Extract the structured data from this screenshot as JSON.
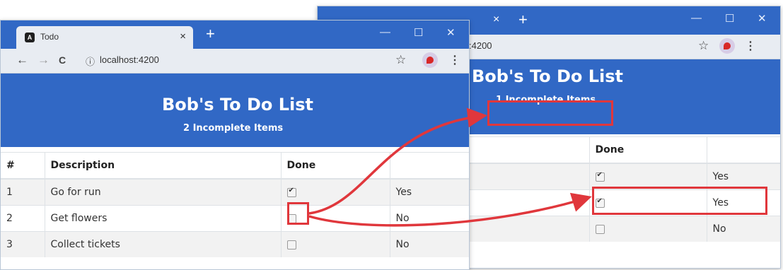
{
  "back_window": {
    "url_partial": ":4200",
    "window_controls": [
      "—",
      "☐",
      "✕"
    ],
    "tab_close": "×",
    "new_tab": "+",
    "banner": {
      "title": "Bob's To Do List",
      "subtitle": "1 Incomplete Items"
    },
    "table": {
      "headers": [
        "",
        "Done",
        ""
      ],
      "rows": [
        {
          "done": true,
          "done_label": "Yes"
        },
        {
          "done": true,
          "done_label": "Yes"
        },
        {
          "done": false,
          "done_label": "No"
        }
      ]
    }
  },
  "front_window": {
    "tab_title": "Todo",
    "tab_close": "×",
    "new_tab": "+",
    "window_controls": [
      "—",
      "☐",
      "✕"
    ],
    "nav": {
      "back": "←",
      "forward": "→",
      "reload": "C",
      "info": "ⓘ",
      "star": "☆",
      "menu": "⋮"
    },
    "url": "localhost:4200",
    "banner": {
      "title": "Bob's To Do List",
      "subtitle": "2 Incomplete Items"
    },
    "table": {
      "headers": [
        "#",
        "Description",
        "Done",
        ""
      ],
      "rows": [
        {
          "num": "1",
          "description": "Go for run",
          "done": true,
          "done_label": "Yes"
        },
        {
          "num": "2",
          "description": "Get flowers",
          "done": false,
          "done_label": "No"
        },
        {
          "num": "3",
          "description": "Collect tickets",
          "done": false,
          "done_label": "No"
        }
      ]
    }
  },
  "colors": {
    "chrome_blue": "#3168c5",
    "highlight_red": "#e0373c"
  }
}
